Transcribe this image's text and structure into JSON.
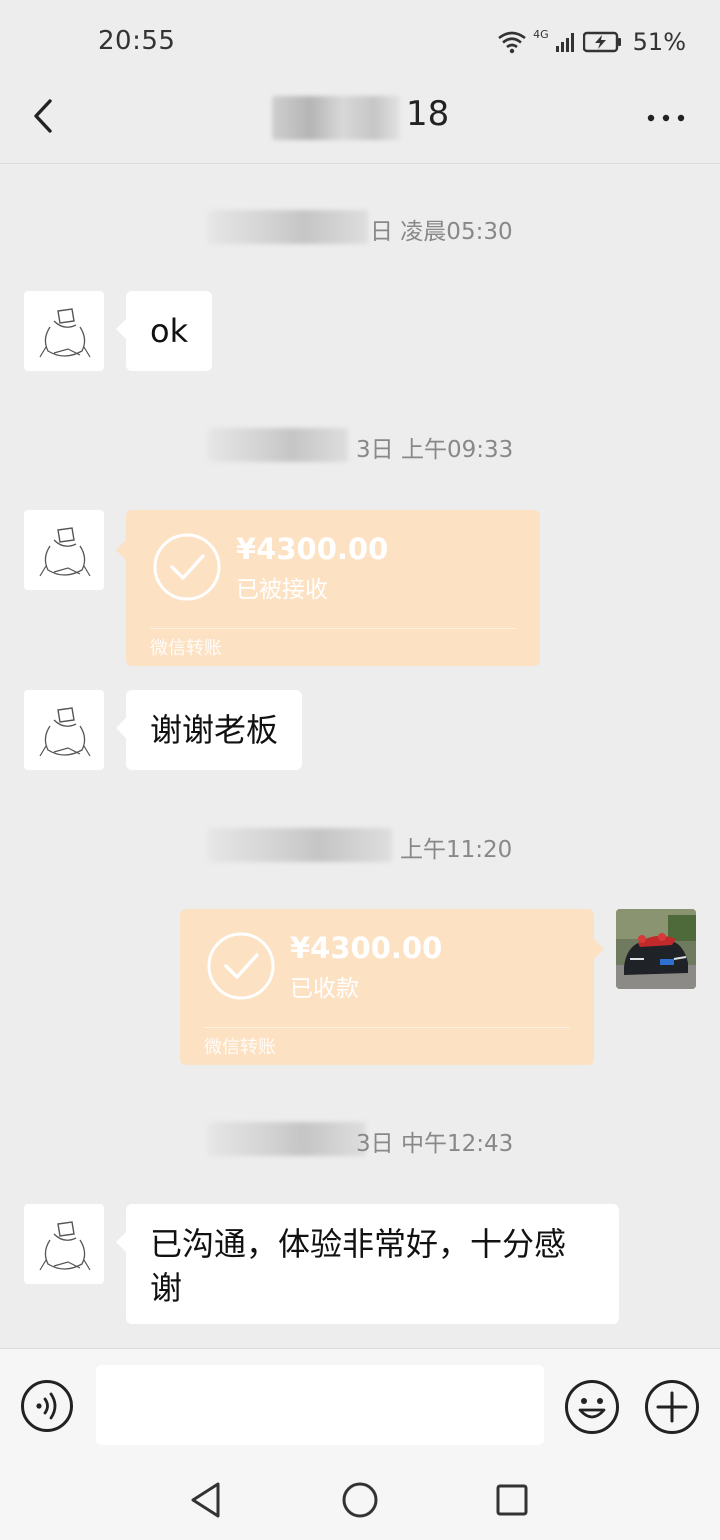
{
  "status_bar": {
    "time": "20:55",
    "network": "4G",
    "battery": "51%",
    "icons": [
      "wifi-icon",
      "signal-icon",
      "battery-charging-icon"
    ]
  },
  "header": {
    "title_suffix": "18",
    "back_icon": "chevron-left-icon",
    "more_icon": "more-dots-icon"
  },
  "messages": [
    {
      "type": "timestamp",
      "text": "日 凌晨05:30"
    },
    {
      "type": "text",
      "side": "left",
      "text": "ok"
    },
    {
      "type": "timestamp",
      "text": "3日 上午09:33"
    },
    {
      "type": "transfer",
      "side": "left",
      "amount": "¥4300.00",
      "status": "已被接收",
      "label": "微信转账"
    },
    {
      "type": "text",
      "side": "left",
      "text": "谢谢老板"
    },
    {
      "type": "timestamp",
      "text": "上午11:20"
    },
    {
      "type": "transfer",
      "side": "right",
      "amount": "¥4300.00",
      "status": "已收款",
      "label": "微信转账"
    },
    {
      "type": "timestamp",
      "text": "3日 中午12:43"
    },
    {
      "type": "text",
      "side": "left",
      "text_line1": "已沟通，体验非常好，十分感",
      "text_line2": "谢"
    }
  ],
  "input_bar": {
    "placeholder": "",
    "voice_icon": "voice-icon",
    "emoji_icon": "emoji-icon",
    "plus_icon": "plus-icon"
  },
  "system_nav": {
    "icons": [
      "nav-back-icon",
      "nav-home-icon",
      "nav-recents-icon"
    ]
  },
  "colors": {
    "background": "#ededed",
    "bubble": "#ffffff",
    "transfer_card": "#fde1c3",
    "timestamp_text": "#888888"
  }
}
